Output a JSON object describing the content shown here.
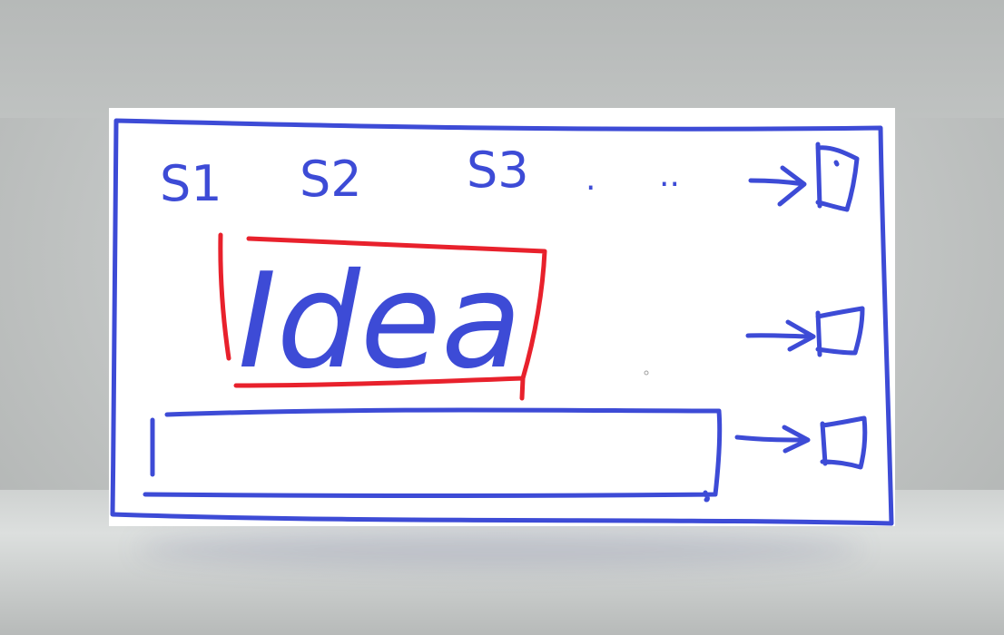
{
  "sketch": {
    "stage_labels": [
      "S1",
      "S2",
      "S3",
      ".",
      "..",
      "→"
    ],
    "idea_label": "Idea",
    "colors": {
      "blue_ink": "#3d4bd6",
      "red_ink": "#e8212c",
      "board": "#ffffff"
    }
  }
}
